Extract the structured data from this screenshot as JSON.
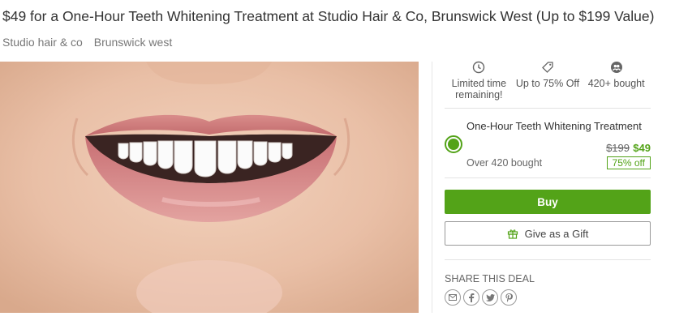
{
  "deal": {
    "title": "$49 for a One-Hour Teeth Whitening Treatment at Studio Hair & Co, Brunswick West (Up to $199 Value)",
    "merchant": "Studio hair & co",
    "location": "Brunswick west"
  },
  "stats": [
    {
      "icon": "clock-icon",
      "line1": "Limited time",
      "line2": "remaining!"
    },
    {
      "icon": "tag-icon",
      "line1": "Up to 75% Off",
      "line2": ""
    },
    {
      "icon": "people-icon",
      "line1": "420+ bought",
      "line2": ""
    }
  ],
  "option": {
    "title": "One-Hour Teeth Whitening Treatment",
    "bought": "Over 420 bought",
    "price_old": "$199",
    "price_new": "$49",
    "discount": "75% off",
    "selected": true
  },
  "buttons": {
    "buy": "Buy",
    "gift": "Give as a Gift"
  },
  "share": {
    "label": "SHARE THIS DEAL",
    "icons": [
      "email-icon",
      "facebook-icon",
      "twitter-icon",
      "pinterest-icon"
    ]
  },
  "colors": {
    "accent": "#53a318",
    "text": "#333333",
    "muted": "#777777"
  }
}
